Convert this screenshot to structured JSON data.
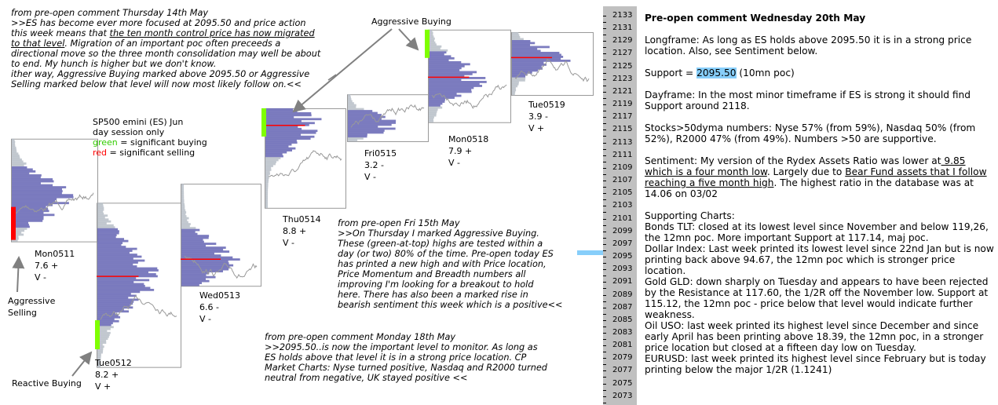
{
  "colors": {
    "profile": "#6e6eb8",
    "profile_outside": "#b4bcc4",
    "price": "#999999",
    "poc": "#ff0000",
    "buying": "#7fff00",
    "selling": "#ff0000",
    "axis_bg": "#c0c0c0",
    "highlight": "#87cefa"
  },
  "notes": {
    "thu14": {
      "l1": "from pre-open comment Thursday 14th May",
      "l2": ">>ES has become ever more focused at 2095.50 and price action",
      "l3a": "this week means that ",
      "l3u": "the ten month control price has now migrated",
      "l4u": "to that level",
      "l4b": ".  Migration of an important poc often preceeds a",
      "l5": "directional move so the three month consolidation may well be about",
      "l6": "to end.  My hunch is higher but we don't know.",
      "l7": " ither way, Aggressive Buying marked above 2095.50 or Aggressive",
      "l8": "Selling marked below that level will now most likely follow on.<<"
    },
    "fri15": [
      "from pre-open Fri 15th May",
      ">>On Thursday I marked Aggressive Buying.",
      "These (green-at-top) highs are tested within a",
      "day (or two) 80% of the time.  Pre-open today ES",
      "has printed a new high and with Price location,",
      "Price Momentum and Breadth numbers all",
      "improving I'm looking for a breakout to hold",
      "here.  There has also been a marked rise in",
      "bearish sentiment this week which is a positive<<"
    ],
    "mon18": [
      "from pre-open comment Monday 18th May",
      ">>2095.50..is now the important level to monitor.  As long as",
      "ES holds above that level it is in a strong price location.  CP",
      "Market Charts: Nyse turned positive, Nasdaq and R2000 turned",
      "neutral from negative,  UK stayed positive <<"
    ]
  },
  "legend": {
    "title": "SP500 emini  (ES)  Jun",
    "sub": "day session only",
    "green_word": "green",
    "green_rest": " = significant buying",
    "red_word": "red",
    "red_rest": " = significant selling"
  },
  "annotations": {
    "aggressive_buying": "Aggressive Buying",
    "aggressive_selling": [
      "Aggressive",
      "Selling"
    ],
    "reactive_buying": "Reactive Buying"
  },
  "sessions": [
    {
      "label": "Mon0511",
      "score": "7.6 +",
      "v": "V -",
      "high": 2113.6,
      "low": 2097.4,
      "poc": 2104.5,
      "marker": "selling"
    },
    {
      "label": "Tue0512",
      "score": "8.2 +",
      "v": "V +",
      "high": 2103.5,
      "low": 2077.6,
      "poc": 2091.9,
      "marker": "buying"
    },
    {
      "label": "Wed0513",
      "score": "6.6 -",
      "v": "V -",
      "high": 2106.5,
      "low": 2090.4,
      "poc": 2094.6,
      "marker": ""
    },
    {
      "label": "Thu0514",
      "score": "8.8 +",
      "v": "V -",
      "high": 2118.4,
      "low": 2102.7,
      "poc": 2115.7,
      "marker": "buying"
    },
    {
      "label": "Fri0515",
      "score": "3.2 -",
      "v": "V -",
      "high": 2120.6,
      "low": 2113.2,
      "poc": 2116.2,
      "marker": ""
    },
    {
      "label": "Mon0518",
      "score": "7.9 +",
      "v": "V -",
      "high": 2130.8,
      "low": 2116.2,
      "poc": 2123.3,
      "marker": "buying"
    },
    {
      "label": "Tue0519",
      "score": "3.9 -",
      "v": "V +",
      "high": 2130.4,
      "low": 2120.5,
      "poc": 2126.4,
      "marker": ""
    }
  ],
  "axis": {
    "ticks": [
      2133,
      2131,
      2129,
      2127,
      2125,
      2123,
      2121,
      2119,
      2117,
      2115,
      2113,
      2111,
      2109,
      2107,
      2105,
      2103,
      2101,
      2099,
      2097,
      2095,
      2093,
      2091,
      2089,
      2087,
      2085,
      2083,
      2081,
      2079,
      2077,
      2075,
      2073
    ],
    "marker_level": 2095.5
  },
  "right": {
    "title": "Pre-open comment Wednesday 20th May",
    "longframe": "Longframe: As long as ES holds above 2095.50 it is in a strong price location.  Also, see Sentiment below.",
    "support_a": "Support = ",
    "support_v": "2095.50",
    "support_b": " (10mn poc)",
    "dayframe": "Dayframe: In the most minor timeframe if ES is strong it should find Support around 2118.",
    "stocks": "Stocks>50dyma numbers: Nyse 57% (from 59%), Nasdaq 50% (from 52%), R2000 47% (from 49%).  Numbers >50 are supportive.",
    "sent_a": "Sentiment:  My version of the Rydex Assets Ratio was lower at",
    "sent_u1": " 9.85 which is a four month low",
    "sent_b": ".  Largely due to ",
    "sent_u2": "Bear Fund assets that I follow reaching a five month high",
    "sent_c": ". The highest ratio in the  database was at 14.06 on 03/02",
    "supporting": [
      "Supporting Charts:",
      "Bonds TLT: closed at its lowest level since November and below 119,26, the 12mn poc.  More important Support at 117.14, maj poc.",
      "Dollar Index:  Last week printed its lowest level since 22nd Jan but is now printing back above 94.67, the 12mn poc which is stronger price location.",
      "Gold GLD: down sharply on Tuesday and appears to have been rejected by the Resistance at 117.60, the 1/2R off the November low.  Support at 115.12, the 12mn poc - price below that level would indicate further weakness.",
      "Oil USO: last week printed its highest level since December and since early April has been printing above 18.39, the 12mn poc, in a stronger price location but closed at a fifteen day low on Tuesday.",
      "EURUSD: last week printed its highest level since February but is today printing below the major 1/2R (1.1241)"
    ]
  }
}
